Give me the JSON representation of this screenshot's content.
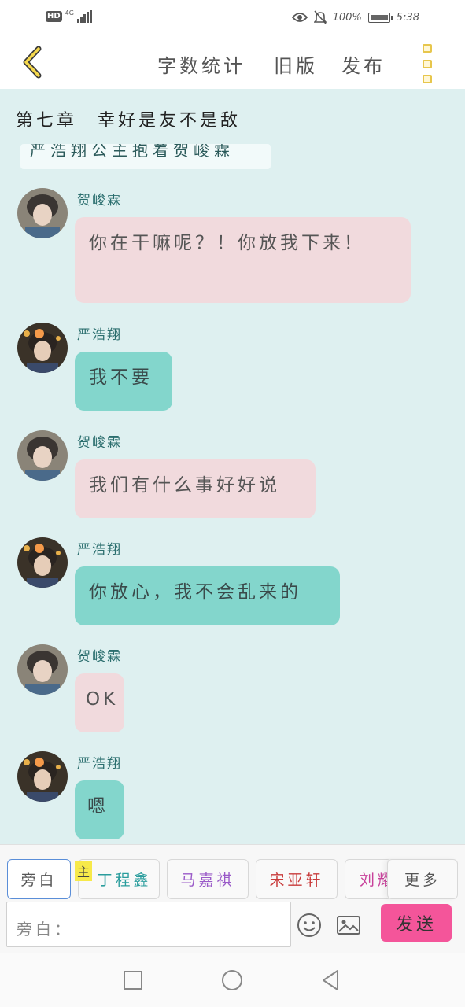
{
  "status_bar": {
    "hd_badge": "HD",
    "network": "4G",
    "battery_percent": "100%",
    "time": "5:38"
  },
  "header": {
    "word_count_label": "字数统计",
    "old_version_label": "旧版",
    "publish_label": "发布"
  },
  "chapter": {
    "title": "第七章　幸好是友不是敌",
    "cut_off_text": "严浩翔公主抱着贺峻霖"
  },
  "messages": [
    {
      "speaker": "贺峻霖",
      "text": "你在干嘛呢？！你放我下来！",
      "style": "pink"
    },
    {
      "speaker": "严浩翔",
      "text": "我不要",
      "style": "teal"
    },
    {
      "speaker": "贺峻霖",
      "text": "我们有什么事好好说",
      "style": "pink"
    },
    {
      "speaker": "严浩翔",
      "text": "你放心，我不会乱来的",
      "style": "teal"
    },
    {
      "speaker": "贺峻霖",
      "text": "OK",
      "style": "pink"
    },
    {
      "speaker": "严浩翔",
      "text": "嗯",
      "style": "teal"
    }
  ],
  "toolbar": {
    "narration_btn": "旁白",
    "main_tag": "主",
    "characters": [
      {
        "name": "丁程鑫",
        "color": "#2a9d9d"
      },
      {
        "name": "马嘉祺",
        "color": "#9a5ac8"
      },
      {
        "name": "宋亚轩",
        "color": "#c83a3a"
      },
      {
        "name": "刘耀文",
        "color": "#c8409a"
      }
    ],
    "more_btn": "更多",
    "input_placeholder": "旁白：",
    "send_btn": "发送"
  },
  "colors": {
    "chat_bg": "#def0f0",
    "pink_bubble": "#f1dadd",
    "teal_bubble": "#83d6cc",
    "send_button": "#f4559a",
    "accent_yellow": "#e7c64c"
  }
}
